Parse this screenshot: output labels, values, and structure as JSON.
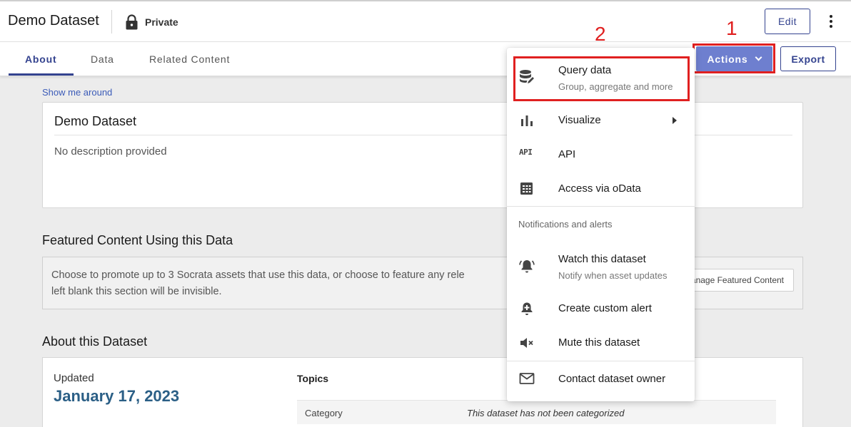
{
  "header": {
    "title": "Demo Dataset",
    "visibility": "Private",
    "edit_label": "Edit"
  },
  "tabs": [
    {
      "label": "About",
      "active": true
    },
    {
      "label": "Data",
      "active": false
    },
    {
      "label": "Related Content",
      "active": false
    }
  ],
  "toolbar": {
    "actions_label": "Actions",
    "export_label": "Export"
  },
  "annotations": {
    "step1": "1",
    "step2": "2"
  },
  "main": {
    "show_me_around": "Show me around",
    "dataset_card": {
      "title": "Demo Dataset",
      "description": "No description provided"
    },
    "featured": {
      "heading": "Featured Content Using this Data",
      "text": "Choose to promote up to 3 Socrata assets that use this data, or choose to feature any rele",
      "text2": "left blank this section will be invisible.",
      "manage_label": "Manage Featured Content"
    },
    "about": {
      "heading": "About this Dataset",
      "updated_label": "Updated",
      "updated_date": "January 17, 2023",
      "topics_label": "Topics",
      "category_label": "Category",
      "category_value": "This dataset has not been categorized"
    }
  },
  "menu": {
    "query": {
      "title": "Query data",
      "subtitle": "Group, aggregate and more"
    },
    "visualize": {
      "title": "Visualize"
    },
    "api": {
      "title": "API",
      "icon_text": "API"
    },
    "odata": {
      "title": "Access via oData"
    },
    "notifications_header": "Notifications and alerts",
    "watch": {
      "title": "Watch this dataset",
      "subtitle": "Notify when asset updates"
    },
    "custom_alert": {
      "title": "Create custom alert"
    },
    "mute": {
      "title": "Mute this dataset"
    },
    "contact": {
      "title": "Contact dataset owner"
    }
  },
  "colors": {
    "accent": "#34438f",
    "actions_bg": "#6e7fcf",
    "highlight": "#e02020",
    "date_blue": "#2b5f86"
  }
}
